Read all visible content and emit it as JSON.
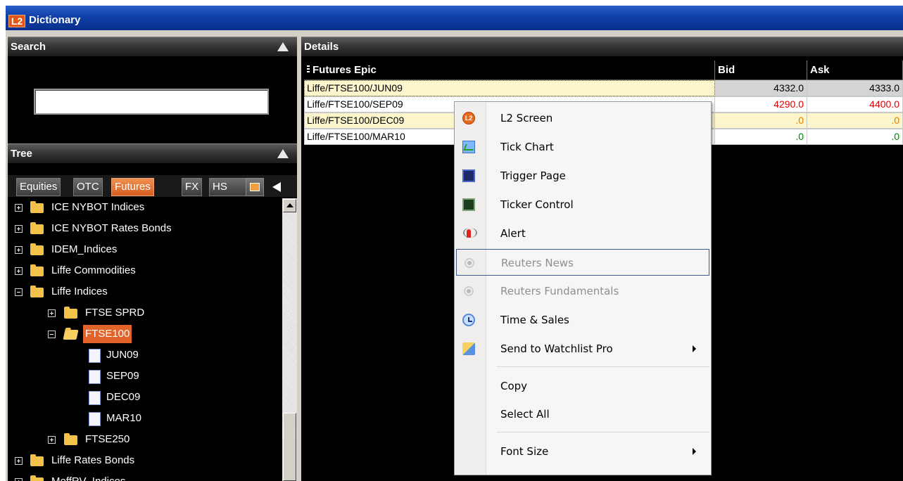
{
  "window": {
    "logo": "L2",
    "title": "Dictionary"
  },
  "search": {
    "header": "Search",
    "value": ""
  },
  "tree_panel": {
    "header": "Tree",
    "tabs": [
      "Equities",
      "OTC",
      "Futures",
      "FX",
      "HS"
    ],
    "active_tab": "Futures",
    "nodes": [
      {
        "label": "ICE NYBOT Indices"
      },
      {
        "label": "ICE NYBOT Rates Bonds"
      },
      {
        "label": "IDEM_Indices"
      },
      {
        "label": "Liffe Commodities"
      },
      {
        "label": "Liffe Indices"
      },
      {
        "label": "FTSE SPRD"
      },
      {
        "label": "FTSE100"
      },
      {
        "label": "JUN09"
      },
      {
        "label": "SEP09"
      },
      {
        "label": "DEC09"
      },
      {
        "label": "MAR10"
      },
      {
        "label": "FTSE250"
      },
      {
        "label": "Liffe Rates Bonds"
      },
      {
        "label": "MeffRV_Indices"
      }
    ]
  },
  "details": {
    "header": "Details",
    "columns": [
      "Futures Epic",
      "Bid",
      "Ask"
    ],
    "rows": [
      {
        "epic": "Liffe/FTSE100/JUN09",
        "bid": "4332.0",
        "ask": "4333.0"
      },
      {
        "epic": "Liffe/FTSE100/SEP09",
        "bid": "4290.0",
        "ask": "4400.0"
      },
      {
        "epic": "Liffe/FTSE100/DEC09",
        "bid": ".0",
        "ask": ".0"
      },
      {
        "epic": "Liffe/FTSE100/MAR10",
        "bid": ".0",
        "ask": ".0"
      }
    ]
  },
  "context_menu": {
    "items": [
      {
        "label": "L2 Screen",
        "icon": "l2-icon"
      },
      {
        "label": "Tick Chart",
        "icon": "chart-icon"
      },
      {
        "label": "Trigger Page",
        "icon": "trigger-icon"
      },
      {
        "label": "Ticker Control",
        "icon": "ticker-icon"
      },
      {
        "label": "Alert",
        "icon": "alert-icon"
      },
      {
        "label": "Reuters News",
        "icon": "reuters-icon",
        "disabled": true
      },
      {
        "label": "Reuters Fundamentals",
        "icon": "reuters-icon",
        "disabled": true
      },
      {
        "label": "Time & Sales",
        "icon": "clock-icon"
      },
      {
        "label": "Send to Watchlist Pro",
        "icon": "watchlist-icon"
      },
      {
        "label": "Copy"
      },
      {
        "label": "Select All"
      },
      {
        "label": "Font Size"
      }
    ]
  },
  "colors": {
    "selected_orange": "#e2642a",
    "row_highlight": "#fdf5cc",
    "negative_red": "#e00000",
    "positive_green": "#008000"
  }
}
